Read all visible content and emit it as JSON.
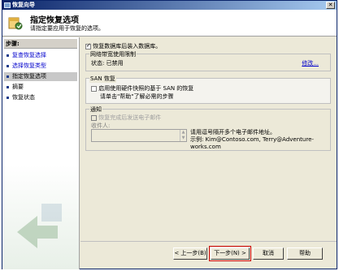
{
  "window": {
    "title": "恢复向导",
    "close_label": "✕"
  },
  "header": {
    "title": "指定恢复选项",
    "subtitle": "请指定要应用于恢复的选项。"
  },
  "sidebar": {
    "title": "步骤:",
    "steps": [
      {
        "label": "复查恢复选择"
      },
      {
        "label": "选择恢复类型"
      },
      {
        "label": "指定恢复选项"
      },
      {
        "label": "摘要"
      },
      {
        "label": "恢复状态"
      }
    ]
  },
  "options": {
    "restore_security_label": "恢复数据库后装入数据库。",
    "bandwidth": {
      "title": "网络带宽使用限制",
      "status": "状态: 已禁用",
      "edit_link": "修改..."
    },
    "san": {
      "title": "SAN 恢复",
      "checkbox_label": "启用使用硬件快照的基于 SAN 的恢复",
      "help_text": "请单击\"帮助\"了解必需的步骤"
    },
    "notification": {
      "title": "通知",
      "checkbox_label": "恢复完成后发送电子邮件",
      "recipient_label": "收件人:",
      "recipient_value": "",
      "hint": "请用逗号隔开多个电子邮件地址。",
      "example": "示例: Kim@Contoso.com, Terry@Adventure-works.com"
    }
  },
  "buttons": {
    "prev": "< 上一步(B)",
    "next": "下一步(N) >",
    "cancel": "取消",
    "help": "帮助"
  },
  "colors": {
    "link": "#0000cc",
    "highlight": "#cc0000",
    "title_bar": "#0a246a"
  }
}
